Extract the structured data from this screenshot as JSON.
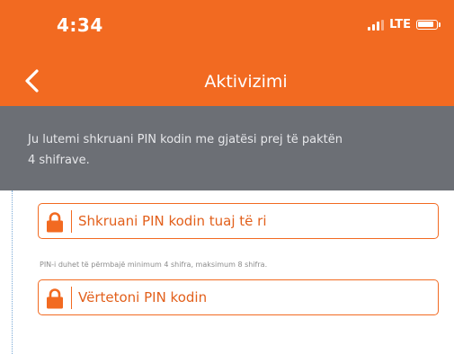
{
  "status_bar": {
    "time": "4:34",
    "network": "LTE",
    "icons": [
      "signal-icon",
      "battery-icon"
    ]
  },
  "nav": {
    "title": "Aktivizimi",
    "back_icon": "chevron-left-icon"
  },
  "banner": {
    "message": "Ju lutemi shkruani PIN kodin me gjatësi prej të paktën 4 shifrave."
  },
  "form": {
    "new_pin": {
      "placeholder": "Shkruani PIN kodin tuaj të ri",
      "value": "",
      "icon": "lock-icon"
    },
    "helper": "PIN-i duhet të përmbajë minimum 4 shifra, maksimum 8 shifra.",
    "confirm_pin": {
      "placeholder": "Vërtetoni PIN kodin",
      "value": "",
      "icon": "lock-icon"
    }
  },
  "colors": {
    "brand_orange": "#f26a21",
    "banner_gray": "#6c6f75",
    "white": "#ffffff"
  }
}
